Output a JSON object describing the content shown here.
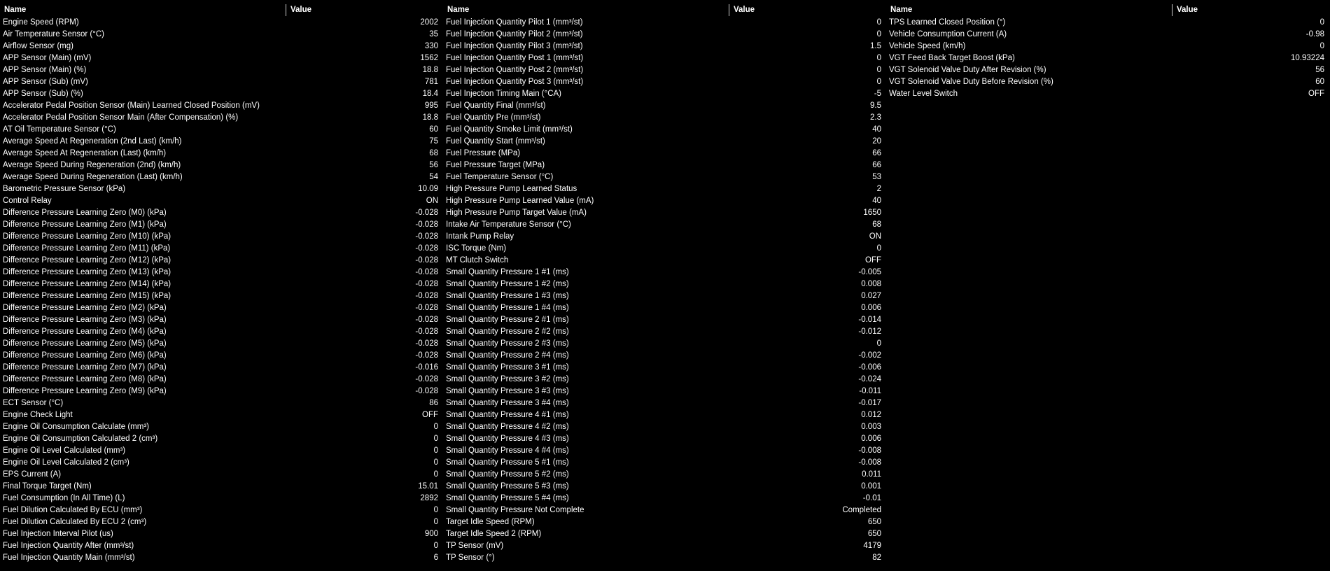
{
  "headers": {
    "name": "Name",
    "value": "Value"
  },
  "columns": [
    {
      "rows": [
        {
          "name": "Engine Speed (RPM)",
          "value": "2002"
        },
        {
          "name": "Air Temperature Sensor (°C)",
          "value": "35"
        },
        {
          "name": "Airflow Sensor (mg)",
          "value": "330"
        },
        {
          "name": "APP Sensor (Main) (mV)",
          "value": "1562"
        },
        {
          "name": "APP Sensor (Main) (%)",
          "value": "18.8"
        },
        {
          "name": "APP Sensor (Sub) (mV)",
          "value": "781"
        },
        {
          "name": "APP Sensor (Sub) (%)",
          "value": "18.4"
        },
        {
          "name": "Accelerator Pedal Position Sensor (Main) Learned Closed Position (mV)",
          "value": "995"
        },
        {
          "name": "Accelerator Pedal Position Sensor Main (After Compensation) (%)",
          "value": "18.8"
        },
        {
          "name": "AT Oil Temperature Sensor (°C)",
          "value": "60"
        },
        {
          "name": "Average Speed At Regeneration (2nd Last) (km/h)",
          "value": "75"
        },
        {
          "name": "Average Speed At Regeneration (Last) (km/h)",
          "value": "68"
        },
        {
          "name": "Average Speed During Regeneration (2nd) (km/h)",
          "value": "56"
        },
        {
          "name": "Average Speed During Regeneration (Last) (km/h)",
          "value": "54"
        },
        {
          "name": "Barometric Pressure Sensor (kPa)",
          "value": "10.09"
        },
        {
          "name": "Control Relay",
          "value": "ON"
        },
        {
          "name": "Difference Pressure Learning Zero (M0) (kPa)",
          "value": "-0.028"
        },
        {
          "name": "Difference Pressure Learning Zero (M1) (kPa)",
          "value": "-0.028"
        },
        {
          "name": "Difference Pressure Learning Zero (M10) (kPa)",
          "value": "-0.028"
        },
        {
          "name": "Difference Pressure Learning Zero (M11) (kPa)",
          "value": "-0.028"
        },
        {
          "name": "Difference Pressure Learning Zero (M12) (kPa)",
          "value": "-0.028"
        },
        {
          "name": "Difference Pressure Learning Zero (M13) (kPa)",
          "value": "-0.028"
        },
        {
          "name": "Difference Pressure Learning Zero (M14) (kPa)",
          "value": "-0.028"
        },
        {
          "name": "Difference Pressure Learning Zero (M15) (kPa)",
          "value": "-0.028"
        },
        {
          "name": "Difference Pressure Learning Zero (M2) (kPa)",
          "value": "-0.028"
        },
        {
          "name": "Difference Pressure Learning Zero (M3) (kPa)",
          "value": "-0.028"
        },
        {
          "name": "Difference Pressure Learning Zero (M4) (kPa)",
          "value": "-0.028"
        },
        {
          "name": "Difference Pressure Learning Zero (M5) (kPa)",
          "value": "-0.028"
        },
        {
          "name": "Difference Pressure Learning Zero (M6) (kPa)",
          "value": "-0.028"
        },
        {
          "name": "Difference Pressure Learning Zero (M7) (kPa)",
          "value": "-0.016"
        },
        {
          "name": "Difference Pressure Learning Zero (M8) (kPa)",
          "value": "-0.028"
        },
        {
          "name": "Difference Pressure Learning Zero (M9) (kPa)",
          "value": "-0.028"
        },
        {
          "name": "ECT Sensor (°C)",
          "value": "86"
        },
        {
          "name": "Engine Check Light",
          "value": "OFF"
        },
        {
          "name": "Engine Oil Consumption Calculate (mm³)",
          "value": "0"
        },
        {
          "name": "Engine Oil Consumption Calculated 2 (cm³)",
          "value": "0"
        },
        {
          "name": "Engine Oil Level Calculated (mm³)",
          "value": "0"
        },
        {
          "name": "Engine Oil Level Calculated 2 (cm³)",
          "value": "0"
        },
        {
          "name": "EPS Current (A)",
          "value": "0"
        },
        {
          "name": "Final Torque Target (Nm)",
          "value": "15.01"
        },
        {
          "name": "Fuel Consumption (In All Time) (L)",
          "value": "2892"
        },
        {
          "name": "Fuel Dilution Calculated By ECU (mm³)",
          "value": "0"
        },
        {
          "name": "Fuel Dilution Calculated By ECU 2 (cm³)",
          "value": "0"
        },
        {
          "name": "Fuel Injection Interval Pilot (us)",
          "value": "900"
        },
        {
          "name": "Fuel Injection Quantity After (mm³/st)",
          "value": "0"
        },
        {
          "name": "Fuel Injection Quantity Main (mm³/st)",
          "value": "6"
        }
      ]
    },
    {
      "rows": [
        {
          "name": "Fuel Injection Quantity Pilot 1 (mm³/st)",
          "value": "0"
        },
        {
          "name": "Fuel Injection Quantity Pilot 2 (mm³/st)",
          "value": "0"
        },
        {
          "name": "Fuel Injection Quantity Pilot 3 (mm³/st)",
          "value": "1.5"
        },
        {
          "name": "Fuel Injection Quantity Post 1 (mm³/st)",
          "value": "0"
        },
        {
          "name": "Fuel Injection Quantity Post 2 (mm³/st)",
          "value": "0"
        },
        {
          "name": "Fuel Injection Quantity Post 3 (mm³/st)",
          "value": "0"
        },
        {
          "name": "Fuel Injection Timing Main (°CA)",
          "value": "-5"
        },
        {
          "name": "Fuel Quantity Final (mm³/st)",
          "value": "9.5"
        },
        {
          "name": "Fuel Quantity Pre (mm³/st)",
          "value": "2.3"
        },
        {
          "name": "Fuel Quantity Smoke Limit (mm³/st)",
          "value": "40"
        },
        {
          "name": "Fuel Quantity Start (mm³/st)",
          "value": "20"
        },
        {
          "name": "Fuel Pressure (MPa)",
          "value": "66"
        },
        {
          "name": "Fuel Pressure Target (MPa)",
          "value": "66"
        },
        {
          "name": "Fuel Temperature Sensor (°C)",
          "value": "53"
        },
        {
          "name": "High Pressure Pump Learned Status",
          "value": "2"
        },
        {
          "name": "High Pressure Pump Learned Value (mA)",
          "value": "40"
        },
        {
          "name": "High Pressure Pump Target Value (mA)",
          "value": "1650"
        },
        {
          "name": "Intake Air Temperature Sensor (°C)",
          "value": "68"
        },
        {
          "name": "Intank Pump Relay",
          "value": "ON"
        },
        {
          "name": "ISC Torque (Nm)",
          "value": "0"
        },
        {
          "name": "MT Clutch Switch",
          "value": "OFF"
        },
        {
          "name": "Small Quantity Pressure 1 #1 (ms)",
          "value": "-0.005"
        },
        {
          "name": "Small Quantity Pressure 1 #2 (ms)",
          "value": "0.008"
        },
        {
          "name": "Small Quantity Pressure 1 #3 (ms)",
          "value": "0.027"
        },
        {
          "name": "Small Quantity Pressure 1 #4 (ms)",
          "value": "0.006"
        },
        {
          "name": "Small Quantity Pressure 2 #1 (ms)",
          "value": "-0.014"
        },
        {
          "name": "Small Quantity Pressure 2 #2 (ms)",
          "value": "-0.012"
        },
        {
          "name": "Small Quantity Pressure 2 #3 (ms)",
          "value": "0"
        },
        {
          "name": "Small Quantity Pressure 2 #4 (ms)",
          "value": "-0.002"
        },
        {
          "name": "Small Quantity Pressure 3 #1 (ms)",
          "value": "-0.006"
        },
        {
          "name": "Small Quantity Pressure 3 #2 (ms)",
          "value": "-0.024"
        },
        {
          "name": "Small Quantity Pressure 3 #3 (ms)",
          "value": "-0.011"
        },
        {
          "name": "Small Quantity Pressure 3 #4 (ms)",
          "value": "-0.017"
        },
        {
          "name": "Small Quantity Pressure 4 #1 (ms)",
          "value": "0.012"
        },
        {
          "name": "Small Quantity Pressure 4 #2 (ms)",
          "value": "0.003"
        },
        {
          "name": "Small Quantity Pressure 4 #3 (ms)",
          "value": "0.006"
        },
        {
          "name": "Small Quantity Pressure 4 #4 (ms)",
          "value": "-0.008"
        },
        {
          "name": "Small Quantity Pressure 5 #1 (ms)",
          "value": "-0.008"
        },
        {
          "name": "Small Quantity Pressure 5 #2 (ms)",
          "value": "0.011"
        },
        {
          "name": "Small Quantity Pressure 5 #3 (ms)",
          "value": "0.001"
        },
        {
          "name": "Small Quantity Pressure 5 #4 (ms)",
          "value": "-0.01"
        },
        {
          "name": "Small Quantity Pressure Not Complete",
          "value": "Completed"
        },
        {
          "name": "Target Idle Speed (RPM)",
          "value": "650"
        },
        {
          "name": "Target Idle Speed 2 (RPM)",
          "value": "650"
        },
        {
          "name": "TP Sensor (mV)",
          "value": "4179"
        },
        {
          "name": "TP Sensor (°)",
          "value": "82"
        }
      ]
    },
    {
      "rows": [
        {
          "name": "TPS Learned Closed Position (°)",
          "value": "0"
        },
        {
          "name": "Vehicle Consumption Current (A)",
          "value": "-0.98"
        },
        {
          "name": "Vehicle Speed (km/h)",
          "value": "0"
        },
        {
          "name": "VGT Feed Back Target Boost (kPa)",
          "value": "10.93224"
        },
        {
          "name": "VGT Solenoid Valve Duty After Revision (%)",
          "value": "56"
        },
        {
          "name": "VGT Solenoid Valve Duty Before Revision (%)",
          "value": "60"
        },
        {
          "name": "Water Level Switch",
          "value": "OFF"
        }
      ]
    }
  ]
}
